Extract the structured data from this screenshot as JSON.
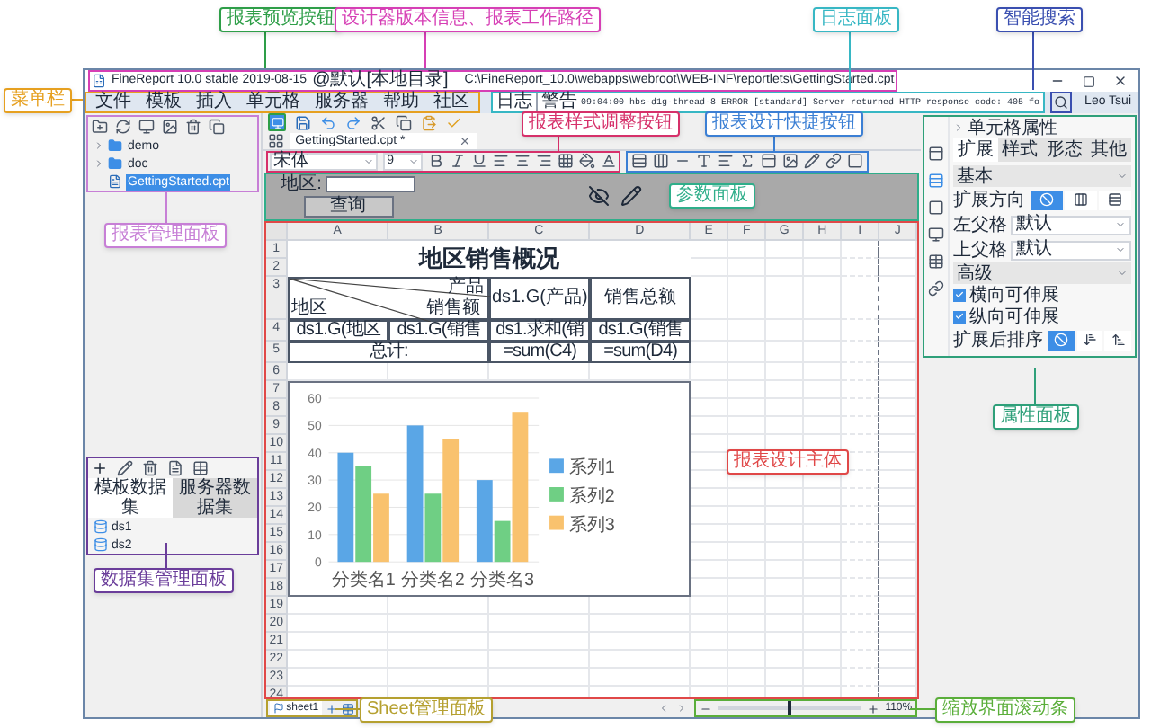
{
  "annotations": [
    {
      "text": "报表预览按钮",
      "color": "#2e9e48"
    },
    {
      "text": "设计器版本信息、报表工作路径",
      "color": "#d63fb5"
    },
    {
      "text": "日志面板",
      "color": "#37b7c4"
    },
    {
      "text": "智能搜索",
      "color": "#3a4fb0"
    },
    {
      "text": "菜单栏",
      "color": "#e6a020"
    },
    {
      "text": "报表样式调整按钮",
      "color": "#d6306a"
    },
    {
      "text": "报表设计快捷按钮",
      "color": "#3b7fd4"
    },
    {
      "text": "报表管理面板",
      "color": "#c77fd6"
    },
    {
      "text": "参数面板",
      "color": "#2fae8a"
    },
    {
      "text": "报表设计主体",
      "color": "#e04848"
    },
    {
      "text": "属性面板",
      "color": "#2fa07a"
    },
    {
      "text": "数据集管理面板",
      "color": "#6a3d9a"
    },
    {
      "text": "Sheet管理面板",
      "color": "#b5a030"
    },
    {
      "text": "缩放界面滚动条",
      "color": "#5aae3a"
    }
  ],
  "window": {
    "app": "FineReport 10.0 stable 2019-08-15",
    "env": "@默认[本地目录]",
    "path": "C:\\FineReport_10.0\\webapps\\webroot\\WEB-INF\\reportlets\\GettingStarted.cpt"
  },
  "menu": [
    "文件",
    "模板",
    "插入",
    "单元格",
    "服务器",
    "帮助",
    "社区"
  ],
  "log": {
    "label": "日志",
    "level": "警告",
    "message": "09:04:00 hbs-d1g-thread-8 ERROR [standard] Server returned HTTP response code: 405 fo"
  },
  "user": "Leo Tsui",
  "report_tree": [
    {
      "label": "demo",
      "kind": "folder",
      "selected": false
    },
    {
      "label": "doc",
      "kind": "folder",
      "selected": false
    },
    {
      "label": "GettingStarted.cpt",
      "kind": "file",
      "selected": true
    }
  ],
  "datasets": {
    "tabs": [
      {
        "label": "模板数据集",
        "selected": true
      },
      {
        "label": "服务器数据集",
        "selected": false
      }
    ],
    "items": [
      "ds1",
      "ds2"
    ]
  },
  "editor_tab": "GettingStarted.cpt *",
  "format_bar": {
    "font": "宋体",
    "size": "9"
  },
  "params": {
    "label": "地区:",
    "button": "查询"
  },
  "grid": {
    "columns": [
      "A",
      "B",
      "C",
      "D",
      "E",
      "F",
      "G",
      "H",
      "I",
      "J"
    ],
    "rows": [
      "1",
      "2",
      "3",
      "4",
      "5",
      "6",
      "7",
      "8",
      "9",
      "10",
      "11",
      "12",
      "13",
      "14",
      "15",
      "16",
      "17",
      "18",
      "19",
      "20",
      "21",
      "22",
      "23",
      "24"
    ]
  },
  "report": {
    "title": "地区销售概况",
    "slash_header": [
      "产品",
      "销售额",
      "地区"
    ],
    "c3": "ds1.G(产品)",
    "d3": "销售总额",
    "row4": [
      "ds1.G(地区",
      "ds1.G(销售",
      "ds1.求和(销",
      "ds1.G(销售"
    ],
    "total_label": "总计:",
    "totals": [
      "=sum(C4)",
      "=sum(D4)"
    ]
  },
  "chart_data": {
    "type": "bar",
    "grid": true,
    "legend": true,
    "categories": [
      "分类名1",
      "分类名2",
      "分类名3"
    ],
    "yticks": [
      0,
      10,
      20,
      30,
      40,
      50,
      60
    ],
    "ylim": [
      0,
      60
    ],
    "series": [
      {
        "name": "系列1",
        "color": "#5aa6e6",
        "values": [
          40,
          50,
          30
        ]
      },
      {
        "name": "系列2",
        "color": "#6fcf84",
        "values": [
          35,
          25,
          15
        ]
      },
      {
        "name": "系列3",
        "color": "#f9c26e",
        "values": [
          25,
          45,
          55
        ]
      }
    ]
  },
  "sheets": [
    {
      "label": "sheet1",
      "selected": true
    }
  ],
  "zoom": {
    "level": 0.5,
    "reading": "110%"
  },
  "properties": {
    "title": "单元格属性",
    "tabs": [
      {
        "label": "扩展",
        "selected": true
      },
      {
        "label": "样式",
        "selected": false
      },
      {
        "label": "形态",
        "selected": false
      },
      {
        "label": "其他",
        "selected": false
      }
    ],
    "basic": "基本",
    "direction_label": "扩展方向",
    "direction_options": [
      {
        "selected": true
      },
      {
        "selected": false
      },
      {
        "selected": false
      }
    ],
    "left_parent": {
      "label": "左父格",
      "value": "默认"
    },
    "top_parent": {
      "label": "上父格",
      "value": "默认"
    },
    "advanced": "高级",
    "checks": [
      {
        "label": "横向可伸展",
        "checked": true
      },
      {
        "label": "纵向可伸展",
        "checked": true
      }
    ],
    "sort_label": "扩展后排序",
    "sort_options": [
      {
        "selected": true
      },
      {
        "selected": false
      },
      {
        "selected": false
      }
    ]
  }
}
